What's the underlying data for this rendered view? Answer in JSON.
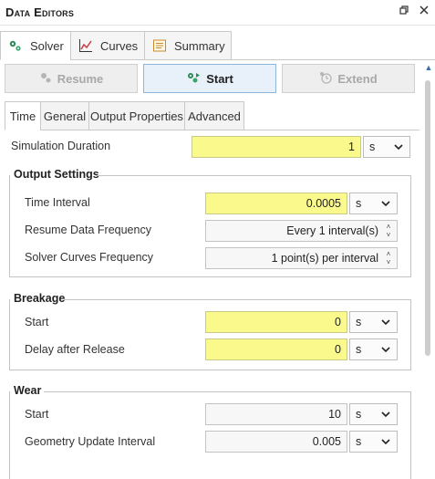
{
  "panel": {
    "title": "Data Editors",
    "restore_icon": "restore-icon",
    "close_icon": "close-icon"
  },
  "top_tabs": [
    {
      "label": "Solver",
      "icon": "gears-icon",
      "active": true
    },
    {
      "label": "Curves",
      "icon": "line-chart-icon",
      "active": false
    },
    {
      "label": "Summary",
      "icon": "document-icon",
      "active": false
    }
  ],
  "actions": {
    "resume": "Resume",
    "start": "Start",
    "extend": "Extend"
  },
  "sub_tabs": [
    "Time",
    "General",
    "Output Properties",
    "Advanced"
  ],
  "simulation": {
    "label": "Simulation Duration",
    "value": "1",
    "unit": "s"
  },
  "output_settings": {
    "title": "Output Settings",
    "time_interval": {
      "label": "Time Interval",
      "value": "0.0005",
      "unit": "s"
    },
    "resume_freq": {
      "label": "Resume Data Frequency",
      "value": "Every 1 interval(s)"
    },
    "solver_curves_freq": {
      "label": "Solver Curves Frequency",
      "value": "1 point(s) per interval"
    }
  },
  "breakage": {
    "title": "Breakage",
    "start": {
      "label": "Start",
      "value": "0",
      "unit": "s"
    },
    "delay": {
      "label": "Delay after Release",
      "value": "0",
      "unit": "s"
    }
  },
  "wear": {
    "title": "Wear",
    "start": {
      "label": "Start",
      "value": "10",
      "unit": "s"
    },
    "geom_update": {
      "label": "Geometry Update Interval",
      "value": "0.005",
      "unit": "s"
    }
  },
  "colors": {
    "highlight": "#fafa8c",
    "accent": "#2a6db0",
    "start_bg": "#e8f1fa"
  }
}
